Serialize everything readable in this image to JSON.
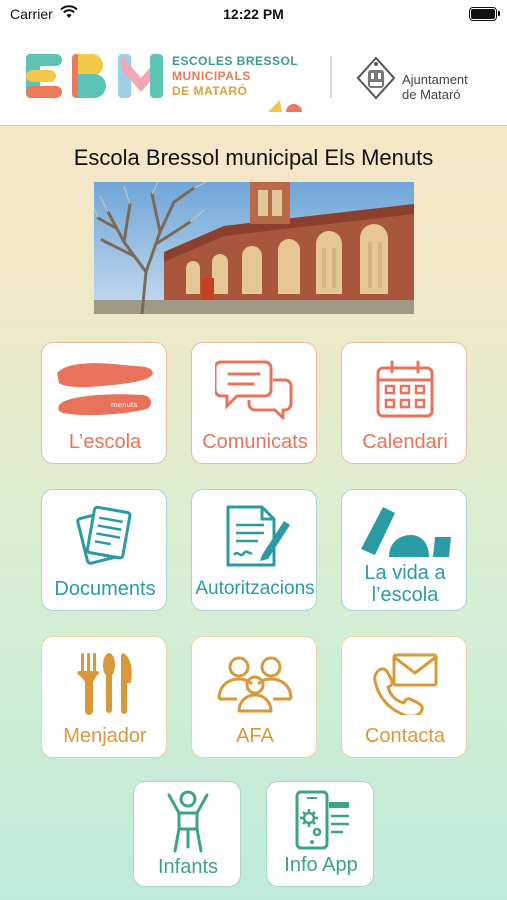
{
  "status_bar": {
    "carrier": "Carrier",
    "time": "12:22 PM"
  },
  "header": {
    "logo_letters": "EBM",
    "logo_line1": "ESCOLES BRESSOL",
    "logo_line2": "MUNICIPALS",
    "logo_line3": "DE MATARÓ",
    "ajuntament_line1": "Ajuntament",
    "ajuntament_line2": "de Mataró"
  },
  "school_title": "Escola Bressol municipal Els Menuts",
  "menu": {
    "lescola": "L’escola",
    "comunicats": "Comunicats",
    "calendari": "Calendari",
    "documents": "Documents",
    "autoritzacions": "Autoritzacions",
    "vida_line1": "La vida a",
    "vida_line2": "l’escola",
    "menjador": "Menjador",
    "afa": "AFA",
    "contacta": "Contacta",
    "infants": "Infants",
    "info_app": "Info App"
  },
  "colors": {
    "orange": "#e8735a",
    "teal": "#2a9ba5",
    "yellow": "#d9993a",
    "green": "#3aa389"
  }
}
